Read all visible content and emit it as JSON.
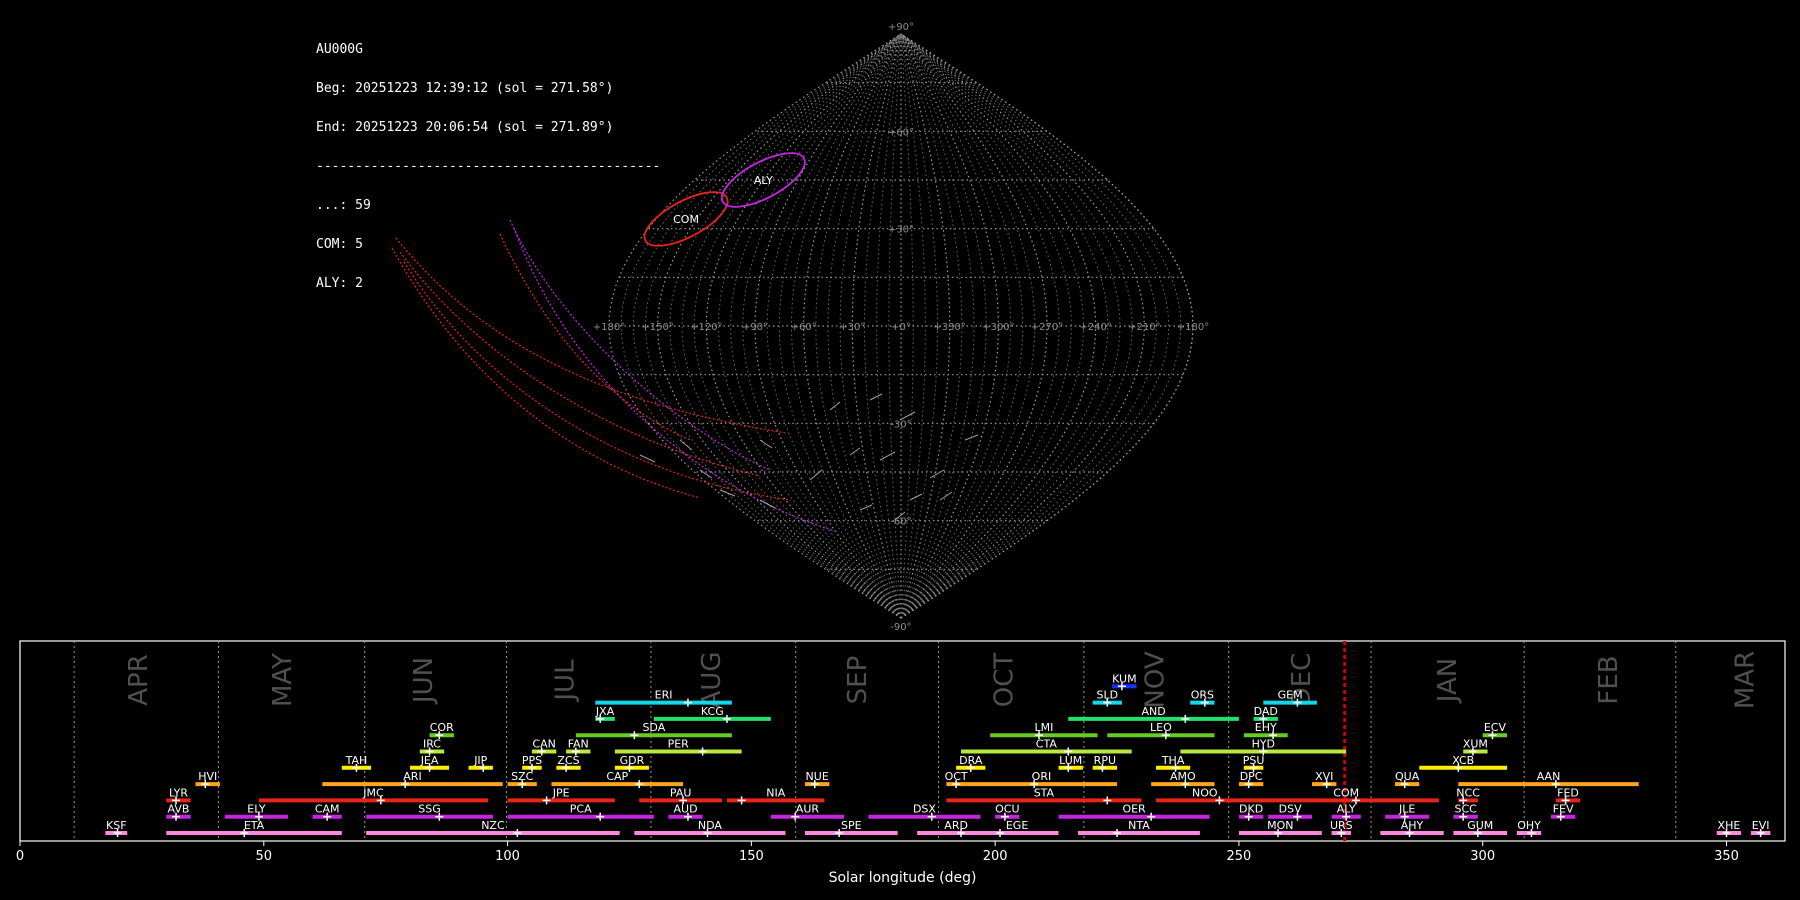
{
  "header": {
    "station": "AU000G",
    "begin": "Beg: 20251223 12:39:12 (sol = 271.58°)",
    "end": "End: 20251223 20:06:54 (sol = 271.89°)",
    "separator": "--------------------------------------------",
    "counts": [
      "...: 59",
      "COM: 5",
      "ALY: 2"
    ]
  },
  "chart_data": [
    {
      "type": "scatter",
      "projection": "sinusoidal",
      "grid": true,
      "lon_ticks": [
        "+180°",
        "+150°",
        "+120°",
        "+90°",
        "+60°",
        "+30°",
        "+0°",
        "+330°",
        "+300°",
        "+270°",
        "+240°",
        "+210°",
        "+180°"
      ],
      "lat_ticks": [
        "+90°",
        "+60°",
        "+30°",
        "-30°",
        "-60°",
        "-90°"
      ],
      "radiants": [
        {
          "name": "COM",
          "lon": 158,
          "lat": 33,
          "color": "#e8241b"
        },
        {
          "name": "ALY",
          "lon": 120,
          "lat": 45,
          "color": "#c525e0"
        }
      ]
    },
    {
      "type": "bar",
      "xlabel": "Solar longitude (deg)",
      "xlim": [
        0,
        362
      ],
      "xticks": [
        0,
        50,
        100,
        150,
        200,
        250,
        300,
        350
      ],
      "month_boundaries": [
        11.1,
        40.7,
        70.7,
        99.8,
        129.4,
        159.1,
        188.4,
        218.2,
        247.9,
        277.1,
        308.5,
        339.6
      ],
      "months": [
        {
          "label": "APR",
          "sol": 24.5
        },
        {
          "label": "MAY",
          "sol": 54.0
        },
        {
          "label": "JUN",
          "sol": 83.0
        },
        {
          "label": "JUL",
          "sol": 112.0
        },
        {
          "label": "AUG",
          "sol": 142.0
        },
        {
          "label": "SEP",
          "sol": 172.0
        },
        {
          "label": "OCT",
          "sol": 202.0
        },
        {
          "label": "NOV",
          "sol": 233.0
        },
        {
          "label": "DEC",
          "sol": 263.0
        },
        {
          "label": "JAN",
          "sol": 293.0
        },
        {
          "label": "FEB",
          "sol": 326.0
        },
        {
          "label": "MAR",
          "sol": 354.0
        }
      ],
      "current_sol": 271.7,
      "current_color": "#cc0000",
      "showers": [
        {
          "code": "KSF",
          "start": 17.5,
          "end": 22,
          "peak": 20,
          "row": 0,
          "color": "#ff88dd"
        },
        {
          "code": "ETA",
          "start": 30,
          "end": 66,
          "peak": 46,
          "row": 0,
          "color": "#ff88dd"
        },
        {
          "code": "NZC",
          "start": 71,
          "end": 123,
          "peak": 102,
          "row": 0,
          "color": "#ff88dd"
        },
        {
          "code": "NDA",
          "start": 126,
          "end": 157,
          "peak": 141,
          "row": 0,
          "color": "#ff88dd"
        },
        {
          "code": "SPE",
          "start": 161,
          "end": 180,
          "peak": 168,
          "row": 0,
          "color": "#ff88dd"
        },
        {
          "code": "ARD",
          "start": 184,
          "end": 200,
          "peak": 193,
          "row": 0,
          "color": "#ff88dd"
        },
        {
          "code": "EGE",
          "start": 196,
          "end": 213,
          "peak": 201,
          "row": 0,
          "color": "#ff88dd"
        },
        {
          "code": "NTA",
          "start": 217,
          "end": 242,
          "peak": 225,
          "row": 0,
          "color": "#ff88dd"
        },
        {
          "code": "MON",
          "start": 250,
          "end": 267,
          "peak": 258,
          "row": 0,
          "color": "#ff88dd"
        },
        {
          "code": "URS",
          "start": 269,
          "end": 273,
          "peak": 271,
          "row": 0,
          "color": "#ff88dd"
        },
        {
          "code": "AHY",
          "start": 279,
          "end": 292,
          "peak": 285,
          "row": 0,
          "color": "#ff88dd"
        },
        {
          "code": "GUM",
          "start": 294,
          "end": 305,
          "peak": 299,
          "row": 0,
          "color": "#ff88dd"
        },
        {
          "code": "OHY",
          "start": 307,
          "end": 312,
          "peak": 310,
          "row": 0,
          "color": "#ff88dd"
        },
        {
          "code": "XHE",
          "start": 348,
          "end": 353,
          "peak": 350,
          "row": 0,
          "color": "#ff88dd"
        },
        {
          "code": "EVI",
          "start": 355,
          "end": 359,
          "peak": 357,
          "row": 0,
          "color": "#ff88dd"
        },
        {
          "code": "AVB",
          "start": 30,
          "end": 35,
          "peak": 32,
          "row": 1,
          "color": "#c525e0"
        },
        {
          "code": "ELY",
          "start": 42,
          "end": 55,
          "peak": 49,
          "row": 1,
          "color": "#c525e0"
        },
        {
          "code": "CAM",
          "start": 60,
          "end": 66,
          "peak": 63,
          "row": 1,
          "color": "#c525e0"
        },
        {
          "code": "SSG",
          "start": 71,
          "end": 97,
          "peak": 86,
          "row": 1,
          "color": "#c525e0"
        },
        {
          "code": "PCA",
          "start": 100,
          "end": 130,
          "peak": 119,
          "row": 1,
          "color": "#c525e0"
        },
        {
          "code": "AUD",
          "start": 133,
          "end": 140,
          "peak": 137,
          "row": 1,
          "color": "#c525e0"
        },
        {
          "code": "AUR",
          "start": 154,
          "end": 169,
          "peak": 159,
          "row": 1,
          "color": "#c525e0"
        },
        {
          "code": "DSX",
          "start": 174,
          "end": 197,
          "peak": 187,
          "row": 1,
          "color": "#c525e0"
        },
        {
          "code": "OCU",
          "start": 200,
          "end": 205,
          "peak": 202,
          "row": 1,
          "color": "#c525e0"
        },
        {
          "code": "OER",
          "start": 213,
          "end": 244,
          "peak": 232,
          "row": 1,
          "color": "#c525e0"
        },
        {
          "code": "DKD",
          "start": 250,
          "end": 255,
          "peak": 252,
          "row": 1,
          "color": "#c525e0"
        },
        {
          "code": "DSV",
          "start": 256,
          "end": 265,
          "peak": 262,
          "row": 1,
          "color": "#c525e0"
        },
        {
          "code": "ALY",
          "start": 269,
          "end": 275,
          "peak": 272,
          "row": 1,
          "color": "#c525e0"
        },
        {
          "code": "JLE",
          "start": 280,
          "end": 289,
          "peak": 284,
          "row": 1,
          "color": "#c525e0"
        },
        {
          "code": "SCC",
          "start": 294,
          "end": 299,
          "peak": 296,
          "row": 1,
          "color": "#c525e0"
        },
        {
          "code": "FEV",
          "start": 314,
          "end": 319,
          "peak": 316,
          "row": 1,
          "color": "#c525e0"
        },
        {
          "code": "LYR",
          "start": 30,
          "end": 35,
          "peak": 32,
          "row": 2,
          "color": "#e8241b"
        },
        {
          "code": "JMC",
          "start": 49,
          "end": 96,
          "peak": 74,
          "row": 2,
          "color": "#e8241b"
        },
        {
          "code": "JPE",
          "start": 100,
          "end": 122,
          "peak": 108,
          "row": 2,
          "color": "#e8241b"
        },
        {
          "code": "PAU",
          "start": 127,
          "end": 144,
          "peak": 136,
          "row": 2,
          "color": "#e8241b"
        },
        {
          "code": "NIA",
          "start": 145,
          "end": 165,
          "peak": 148,
          "row": 2,
          "color": "#e8241b"
        },
        {
          "code": "STA",
          "start": 190,
          "end": 230,
          "peak": 223,
          "row": 2,
          "color": "#e8241b"
        },
        {
          "code": "NOO",
          "start": 233,
          "end": 253,
          "peak": 246,
          "row": 2,
          "color": "#e8241b"
        },
        {
          "code": "COM",
          "start": 253,
          "end": 291,
          "peak": 274,
          "row": 2,
          "color": "#e8241b"
        },
        {
          "code": "NCC",
          "start": 295,
          "end": 299,
          "peak": 296,
          "row": 2,
          "color": "#e8241b"
        },
        {
          "code": "FED",
          "start": 315,
          "end": 320,
          "peak": 317,
          "row": 2,
          "color": "#e8241b"
        },
        {
          "code": "HVI",
          "start": 36,
          "end": 41,
          "peak": 38,
          "row": 3,
          "color": "#ffa51f"
        },
        {
          "code": "ARI",
          "start": 62,
          "end": 99,
          "peak": 79,
          "row": 3,
          "color": "#ffa51f"
        },
        {
          "code": "SZC",
          "start": 100,
          "end": 106,
          "peak": 103,
          "row": 3,
          "color": "#ffa51f"
        },
        {
          "code": "CAP",
          "start": 109,
          "end": 136,
          "peak": 127,
          "row": 3,
          "color": "#ffa51f"
        },
        {
          "code": "NUE",
          "start": 161,
          "end": 166,
          "peak": 163,
          "row": 3,
          "color": "#ffa51f"
        },
        {
          "code": "OCT",
          "start": 190,
          "end": 194,
          "peak": 192,
          "row": 3,
          "color": "#ffa51f"
        },
        {
          "code": "ORI",
          "start": 194,
          "end": 225,
          "peak": 208,
          "row": 3,
          "color": "#ffa51f"
        },
        {
          "code": "AMO",
          "start": 232,
          "end": 245,
          "peak": 239,
          "row": 3,
          "color": "#ffa51f"
        },
        {
          "code": "DPC",
          "start": 250,
          "end": 255,
          "peak": 252,
          "row": 3,
          "color": "#ffa51f"
        },
        {
          "code": "XVI",
          "start": 265,
          "end": 270,
          "peak": 268,
          "row": 3,
          "color": "#ffa51f"
        },
        {
          "code": "QUA",
          "start": 282,
          "end": 287,
          "peak": 284,
          "row": 3,
          "color": "#ffa51f"
        },
        {
          "code": "AAN",
          "start": 295,
          "end": 332,
          "peak": 315,
          "row": 3,
          "color": "#ffa51f"
        },
        {
          "code": "TAH",
          "start": 66,
          "end": 72,
          "peak": 69,
          "row": 4,
          "color": "#ffee00"
        },
        {
          "code": "JEA",
          "start": 80,
          "end": 88,
          "peak": 84,
          "row": 4,
          "color": "#ffee00"
        },
        {
          "code": "JIP",
          "start": 92,
          "end": 97,
          "peak": 95,
          "row": 4,
          "color": "#ffee00"
        },
        {
          "code": "PPS",
          "start": 103,
          "end": 107,
          "peak": 105,
          "row": 4,
          "color": "#ffee00"
        },
        {
          "code": "ZCS",
          "start": 110,
          "end": 115,
          "peak": 112,
          "row": 4,
          "color": "#ffee00"
        },
        {
          "code": "GDR",
          "start": 122,
          "end": 129,
          "peak": 125,
          "row": 4,
          "color": "#ffee00"
        },
        {
          "code": "DRA",
          "start": 192,
          "end": 198,
          "peak": 195,
          "row": 4,
          "color": "#ffee00"
        },
        {
          "code": "LUM",
          "start": 213,
          "end": 218,
          "peak": 215,
          "row": 4,
          "color": "#ffee00"
        },
        {
          "code": "RPU",
          "start": 220,
          "end": 225,
          "peak": 222,
          "row": 4,
          "color": "#ffee00"
        },
        {
          "code": "THA",
          "start": 233,
          "end": 240,
          "peak": 237,
          "row": 4,
          "color": "#ffee00"
        },
        {
          "code": "PSU",
          "start": 251,
          "end": 255,
          "peak": 253,
          "row": 4,
          "color": "#ffee00"
        },
        {
          "code": "XCB",
          "start": 287,
          "end": 305,
          "peak": 295,
          "row": 4,
          "color": "#ffee00"
        },
        {
          "code": "IRC",
          "start": 82,
          "end": 87,
          "peak": 84,
          "row": 5,
          "color": "#b8e840"
        },
        {
          "code": "CAN",
          "start": 105,
          "end": 110,
          "peak": 107,
          "row": 5,
          "color": "#b8e840"
        },
        {
          "code": "FAN",
          "start": 112,
          "end": 117,
          "peak": 114,
          "row": 5,
          "color": "#b8e840"
        },
        {
          "code": "PER",
          "start": 122,
          "end": 148,
          "peak": 140,
          "row": 5,
          "color": "#b8e840"
        },
        {
          "code": "CTA",
          "start": 193,
          "end": 228,
          "peak": 215,
          "row": 5,
          "color": "#b8e840"
        },
        {
          "code": "HYD",
          "start": 238,
          "end": 272,
          "peak": 255,
          "row": 5,
          "color": "#b8e840"
        },
        {
          "code": "XUM",
          "start": 296,
          "end": 301,
          "peak": 298,
          "row": 5,
          "color": "#b8e840"
        },
        {
          "code": "COR",
          "start": 84,
          "end": 89,
          "peak": 86,
          "row": 6,
          "color": "#66cc22"
        },
        {
          "code": "SDA",
          "start": 114,
          "end": 146,
          "peak": 126,
          "row": 6,
          "color": "#66cc22"
        },
        {
          "code": "LMI",
          "start": 199,
          "end": 221,
          "peak": 209,
          "row": 6,
          "color": "#66cc22"
        },
        {
          "code": "LEO",
          "start": 223,
          "end": 245,
          "peak": 235,
          "row": 6,
          "color": "#66cc22"
        },
        {
          "code": "EHY",
          "start": 251,
          "end": 260,
          "peak": 257,
          "row": 6,
          "color": "#66cc22"
        },
        {
          "code": "ECV",
          "start": 300,
          "end": 305,
          "peak": 302,
          "row": 6,
          "color": "#66cc22"
        },
        {
          "code": "JXA",
          "start": 118,
          "end": 122,
          "peak": 119,
          "row": 7,
          "color": "#22e070"
        },
        {
          "code": "KCG",
          "start": 130,
          "end": 154,
          "peak": 145,
          "row": 7,
          "color": "#22e070"
        },
        {
          "code": "AND",
          "start": 215,
          "end": 250,
          "peak": 239,
          "row": 7,
          "color": "#22e070"
        },
        {
          "code": "DAD",
          "start": 253,
          "end": 258,
          "peak": 255,
          "row": 7,
          "color": "#22e070"
        },
        {
          "code": "ERI",
          "start": 118,
          "end": 146,
          "peak": 137,
          "row": 8,
          "color": "#10d8e8"
        },
        {
          "code": "SLD",
          "start": 220,
          "end": 226,
          "peak": 223,
          "row": 8,
          "color": "#10d8e8"
        },
        {
          "code": "ORS",
          "start": 240,
          "end": 245,
          "peak": 243,
          "row": 8,
          "color": "#10d8e8"
        },
        {
          "code": "GEM",
          "start": 255,
          "end": 266,
          "peak": 262,
          "row": 8,
          "color": "#10d8e8"
        },
        {
          "code": "KUM",
          "start": 224,
          "end": 229,
          "peak": 226,
          "row": 9,
          "color": "#1a30ff"
        }
      ]
    }
  ]
}
